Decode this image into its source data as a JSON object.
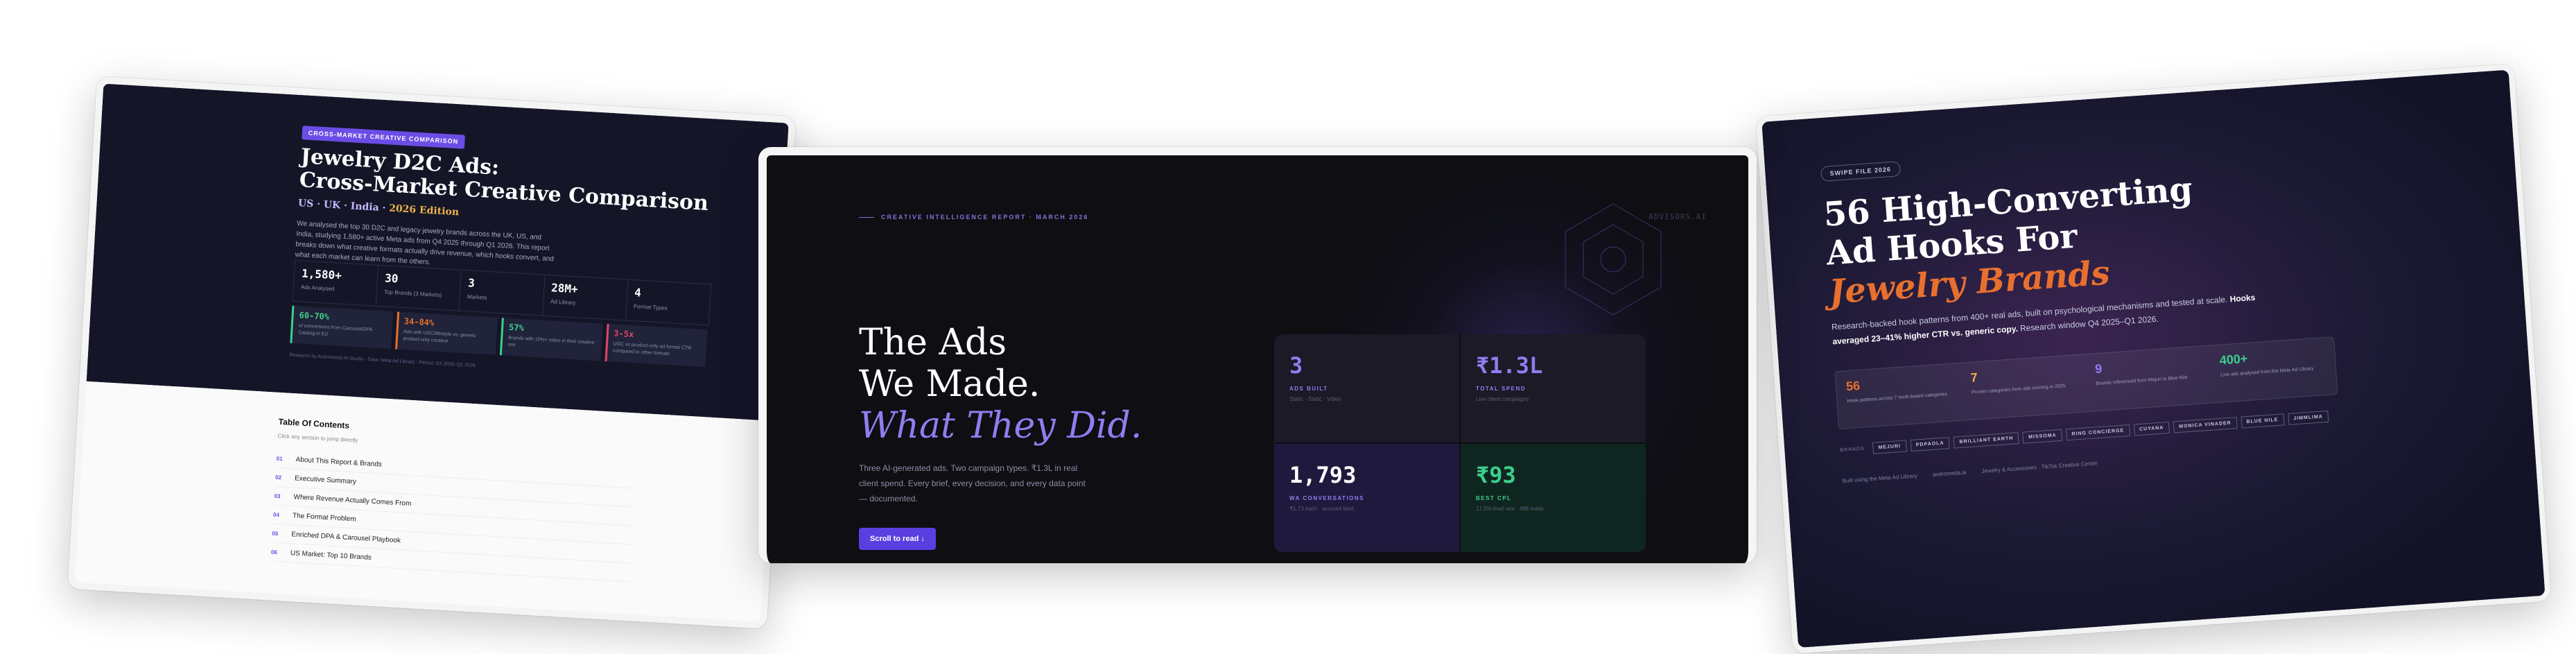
{
  "left_report": {
    "tag": "CROSS-MARKET CREATIVE COMPARISON",
    "title_line1": "Jewelry D2C Ads:",
    "title_line2": "Cross-Market Creative Comparison",
    "sub_markets": "US · UK · India ·",
    "sub_edition": "2026 Edition",
    "description": "We analysed the top 30 D2C and legacy jewelry brands across the UK, US, and India, studying 1,580+ active Meta ads from Q4 2025 through Q1 2026. This report breaks down what creative formats actually drive revenue, which hooks convert, and what each market can learn from the others.",
    "stats": [
      {
        "value": "1,580+",
        "label": "Ads Analysed"
      },
      {
        "value": "30",
        "label": "Top Brands (3 Markets)"
      },
      {
        "value": "3",
        "label": "Markets"
      },
      {
        "value": "28M+",
        "label": "Ad Library"
      },
      {
        "value": "4",
        "label": "Format Types"
      }
    ],
    "chips": [
      {
        "value": "60-70%",
        "text": "of conversions from Carousel/DPA Catalog in EU",
        "color": "#3ccf8e"
      },
      {
        "value": "34-84%",
        "text": "Ads with UGC/lifestyle vs. generic product-only creative",
        "color": "#e8702e"
      },
      {
        "value": "57%",
        "text": "Brands with 10%+ video in their creative mix",
        "color": "#3ccf8e"
      },
      {
        "value": "3-5x",
        "text": "UGC vs product-only ad format CTR compared to other formats",
        "color": "#e2466b"
      }
    ],
    "footnote": "Research by Andromeda AI Studio · Data: Meta Ad Library · Period: Q4 2025–Q1 2026",
    "toc_title": "Table Of Contents",
    "toc_hint": "Click any section to jump directly",
    "toc": [
      {
        "num": "01",
        "label": "About This Report & Brands"
      },
      {
        "num": "02",
        "label": "Executive Summary"
      },
      {
        "num": "03",
        "label": "Where Revenue Actually Comes From"
      },
      {
        "num": "04",
        "label": "The Format Problem"
      },
      {
        "num": "05",
        "label": "Enriched DPA & Carousel Playbook"
      },
      {
        "num": "06",
        "label": "US Market: Top 10 Brands"
      }
    ]
  },
  "center_report": {
    "header": "CREATIVE INTELLIGENCE REPORT · MARCH 2026",
    "brand": "ADVISORS.AI",
    "title_line1": "The Ads",
    "title_line2": "We Made.",
    "title_line3": "What They Did.",
    "description": "Three AI-generated ads. Two campaign types. ₹1.3L in real client spend. Every brief, every decision, and every data point — documented.",
    "button_label": "Scroll to read ↓",
    "metrics": [
      {
        "value": "3",
        "label": "ADS BUILT",
        "sub": "Static · Static · Video",
        "color": "#8e7ef0"
      },
      {
        "value": "₹1.3L",
        "label": "TOTAL SPEND",
        "sub": "Live client campaigns",
        "color": "#8e7ef0"
      },
      {
        "value": "1,793",
        "label": "WA CONVERSATIONS",
        "sub": "₹1.73 each · account best",
        "color": "#ffffff"
      },
      {
        "value": "₹93",
        "label": "BEST CPL",
        "sub": "17.5% lead rate · 486 leads",
        "color": "#3ccf8e"
      }
    ],
    "colors": {
      "accent": "#8e7ef0",
      "button": "#5a3ee0",
      "green": "#3ccf8e"
    }
  },
  "right_report": {
    "tag": "SWIPE FILE 2026",
    "title_line1": "56 High-Converting",
    "title_line2": "Ad Hooks For",
    "title_line3": "Jewelry Brands",
    "description_pre": "Research-backed hook patterns from 400+ real ads, built on psychological mechanisms and tested at scale.",
    "description_bold": "Hooks averaged 23–41% higher CTR vs. generic copy.",
    "description_post": "Research window Q4 2025–Q1 2026.",
    "stats": [
      {
        "value": "56",
        "text": "Hook patterns across 7 hook-based categories",
        "color": "#e8702e"
      },
      {
        "value": "7",
        "text": "Proven categories from ads running in 2025",
        "color": "#f0b247"
      },
      {
        "value": "9",
        "text": "Brands referenced from Mejuri to Blue Nile",
        "color": "#8e7ef0"
      },
      {
        "value": "400+",
        "text": "Live ads analysed from the Meta Ad Library",
        "color": "#3ccf8e"
      }
    ],
    "brands_label": "BRANDS",
    "brands": [
      "MEJURI",
      "PDPAOLA",
      "BRILLIANT EARTH",
      "MISSOMA",
      "RING CONCIERGE",
      "CUYANA",
      "MONICA VINADER",
      "BLUE NILE",
      "JIMMLIMA"
    ],
    "footer": [
      "Built using the Meta Ad Library",
      "andromeda.ai",
      "Jewelry & Accessories · TikTok Creative Center"
    ]
  }
}
